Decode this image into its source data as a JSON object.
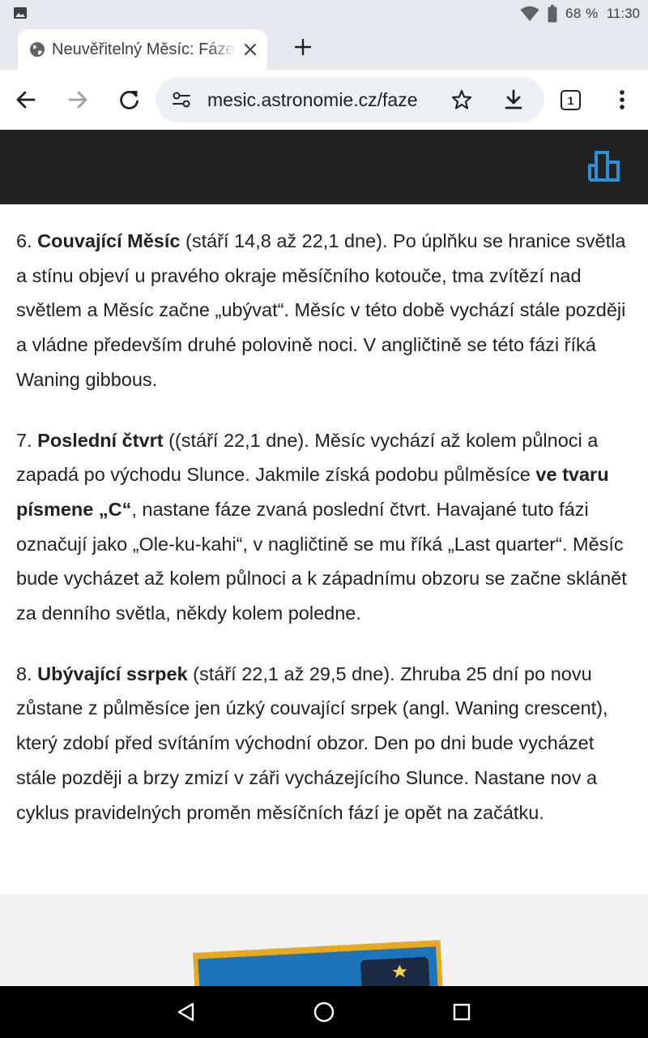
{
  "status_bar": {
    "left_icon": "image-icon",
    "battery_percent": "68 %",
    "time": "11:30",
    "icons": [
      "wifi-icon",
      "battery-icon"
    ]
  },
  "tab": {
    "title": "Neuvěřitelný Měsíc: Fáze",
    "icon": "globe-icon",
    "close_icon": "close-icon"
  },
  "new_tab_icon": "plus-icon",
  "toolbar": {
    "url": "mesic.astronomie.cz/faze",
    "tab_count": "1",
    "icons": [
      "back-icon",
      "forward-icon",
      "reload-icon",
      "site-settings-icon",
      "bookmark-star-icon",
      "download-icon",
      "more-menu-icon"
    ]
  },
  "site_header": {
    "logo": "chart-logo-icon",
    "accent": "#2d8fd5",
    "background": "#222222"
  },
  "article": {
    "paragraphs": [
      {
        "number": "6. ",
        "heading": "Couvající Měsíc",
        "text": " (stáří 14,8 až 22,1 dne). Po úplňku se hranice světla a stínu objeví u pravého okraje měsíčního kotouče, tma zvítězí nad světlem a Měsíc začne „ubývat“. Měsíc v této době vychází stále později a vládne především druhé polovině noci. V angličtině se této fázi říká Waning gibbous."
      },
      {
        "number": "7. ",
        "heading": "Poslední čtvrt",
        "text_a": " ((stáří 22,1 dne). Měsíc vychází až kolem půlnoci a zapadá po východu Slunce. Jakmile získá podobu půlměsíce ",
        "bold_b": "ve tvaru písmene „C“",
        "text_c": ", nastane fáze zvaná poslední čtvrt. Havajané tuto fázi označují jako „Ole-ku-kahi“, v nagličtině se mu říká „Last quarter“. Měsíc bude vycházet až kolem půlnoci a k západnímu obzoru se začne sklánět za denního světla, někdy kolem poledne."
      },
      {
        "number": "8. ",
        "heading": "Ubývající ssrpek",
        "text": " (stáří 22,1 až 29,5 dne). Zhruba 25 dní po novu zůstane z půlměsíce jen úzký couvající srpek (angl. Waning crescent), který zdobí před svítáním východní obzor. Den po dni bude vycházet stále později a brzy zmizí v záři vycházejícího Slunce. Nastane nov a cyklus pravidelných proměn měsíčních fází je opět na začátku."
      }
    ]
  },
  "promo": {
    "image": "book-cover-image"
  },
  "navigation_bar": {
    "icons": [
      "back-triangle-icon",
      "home-circle-icon",
      "recents-square-icon"
    ]
  }
}
